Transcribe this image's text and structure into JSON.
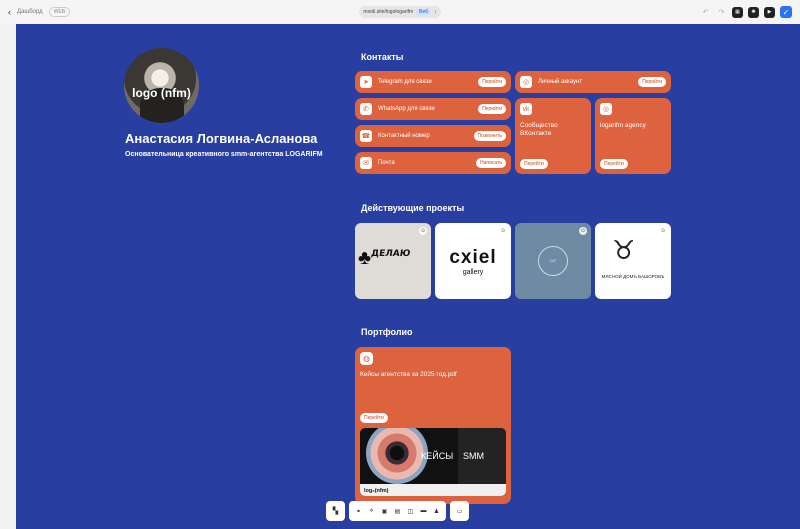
{
  "topbar": {
    "back_label": "Дашборд",
    "status_badge": "WEB",
    "url": "mooli.site/logologarifm",
    "url_badge": "Веб",
    "url_arrow": "↕"
  },
  "toolbar": {
    "undo_icon": "↶",
    "redo_icon": "↷",
    "qr_icon": "▦",
    "settings_icon": "✺",
    "play_icon": "▶",
    "publish_icon": "✓"
  },
  "profile": {
    "avatar_text": "logo (nfm)",
    "name": "Анастасия Логвина-Асланова",
    "role": "Основательница креативного smm-агентства LOGARIFM"
  },
  "contacts": {
    "title": "Контакты",
    "telegram": {
      "label": "Telegram для связи",
      "button": "Перейти",
      "icon": "➤"
    },
    "whatsapp": {
      "label": "WhatsApp для связи",
      "button": "Перейти",
      "icon": "✆"
    },
    "phone": {
      "label": "Контактный номер",
      "button": "Позвонить",
      "icon": "☎"
    },
    "mail": {
      "label": "Почта",
      "button": "Написать",
      "icon": "✉"
    },
    "instagram_personal": {
      "label": "Личный аккаунт",
      "button": "Перейти",
      "icon": "◎"
    },
    "vk": {
      "label": "Сообщество ВКонтакте",
      "button": "Перейти",
      "icon": "vk"
    },
    "instagram_agency": {
      "label": "logarifm agency",
      "button": "Перейти",
      "icon": "◎"
    }
  },
  "projects": {
    "title": "Действующие проекты",
    "items": [
      {
        "text": "ДЕЛАЮ",
        "bg": "#dfdbd6"
      },
      {
        "text": "cxiel",
        "subtitle": "gallery",
        "bg": "#ffffff"
      },
      {
        "text": "CAT",
        "bg": "#6f8aa3"
      },
      {
        "text": "МЯСНОЙ ДОМЪ БАШОРОВЪ",
        "bg": "#ffffff"
      }
    ],
    "pin_icon": "⊙"
  },
  "portfolio": {
    "title": "Портфолио",
    "file_label": "Кейсы агентства за 2025 год.pdf",
    "button": "Перейти",
    "icon": "◍",
    "preview_left": "КЕЙСЫ",
    "preview_right": "SMM",
    "preview_logo": "log₀(nfm)"
  },
  "dock": {
    "grid_icon": "▚",
    "link_icon": "⚭",
    "icons": [
      "⟡",
      "▣",
      "▤",
      "◫",
      "▬",
      "♟"
    ],
    "monitor_icon": "▭"
  },
  "colors": {
    "canvas": "#283ea0",
    "accent": "#dd623e"
  }
}
